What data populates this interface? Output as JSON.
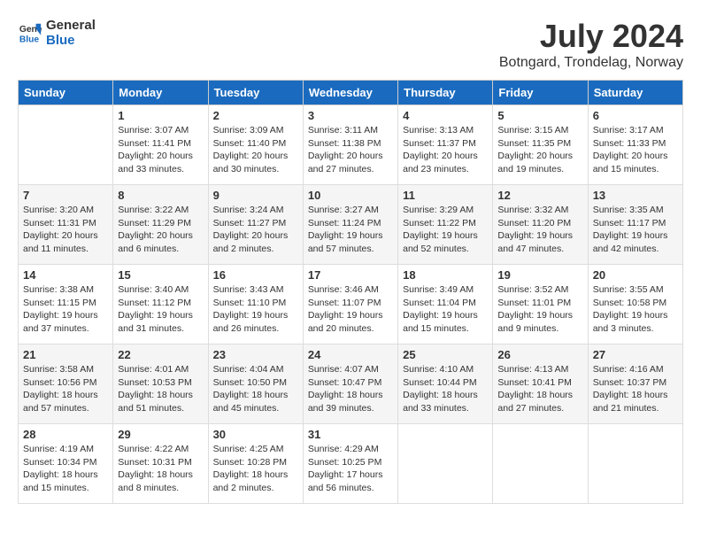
{
  "header": {
    "logo_general": "General",
    "logo_blue": "Blue",
    "title": "July 2024",
    "location": "Botngard, Trondelag, Norway"
  },
  "columns": [
    "Sunday",
    "Monday",
    "Tuesday",
    "Wednesday",
    "Thursday",
    "Friday",
    "Saturday"
  ],
  "weeks": [
    [
      {
        "day": "",
        "info": ""
      },
      {
        "day": "1",
        "info": "Sunrise: 3:07 AM\nSunset: 11:41 PM\nDaylight: 20 hours\nand 33 minutes."
      },
      {
        "day": "2",
        "info": "Sunrise: 3:09 AM\nSunset: 11:40 PM\nDaylight: 20 hours\nand 30 minutes."
      },
      {
        "day": "3",
        "info": "Sunrise: 3:11 AM\nSunset: 11:38 PM\nDaylight: 20 hours\nand 27 minutes."
      },
      {
        "day": "4",
        "info": "Sunrise: 3:13 AM\nSunset: 11:37 PM\nDaylight: 20 hours\nand 23 minutes."
      },
      {
        "day": "5",
        "info": "Sunrise: 3:15 AM\nSunset: 11:35 PM\nDaylight: 20 hours\nand 19 minutes."
      },
      {
        "day": "6",
        "info": "Sunrise: 3:17 AM\nSunset: 11:33 PM\nDaylight: 20 hours\nand 15 minutes."
      }
    ],
    [
      {
        "day": "7",
        "info": "Sunrise: 3:20 AM\nSunset: 11:31 PM\nDaylight: 20 hours\nand 11 minutes."
      },
      {
        "day": "8",
        "info": "Sunrise: 3:22 AM\nSunset: 11:29 PM\nDaylight: 20 hours\nand 6 minutes."
      },
      {
        "day": "9",
        "info": "Sunrise: 3:24 AM\nSunset: 11:27 PM\nDaylight: 20 hours\nand 2 minutes."
      },
      {
        "day": "10",
        "info": "Sunrise: 3:27 AM\nSunset: 11:24 PM\nDaylight: 19 hours\nand 57 minutes."
      },
      {
        "day": "11",
        "info": "Sunrise: 3:29 AM\nSunset: 11:22 PM\nDaylight: 19 hours\nand 52 minutes."
      },
      {
        "day": "12",
        "info": "Sunrise: 3:32 AM\nSunset: 11:20 PM\nDaylight: 19 hours\nand 47 minutes."
      },
      {
        "day": "13",
        "info": "Sunrise: 3:35 AM\nSunset: 11:17 PM\nDaylight: 19 hours\nand 42 minutes."
      }
    ],
    [
      {
        "day": "14",
        "info": "Sunrise: 3:38 AM\nSunset: 11:15 PM\nDaylight: 19 hours\nand 37 minutes."
      },
      {
        "day": "15",
        "info": "Sunrise: 3:40 AM\nSunset: 11:12 PM\nDaylight: 19 hours\nand 31 minutes."
      },
      {
        "day": "16",
        "info": "Sunrise: 3:43 AM\nSunset: 11:10 PM\nDaylight: 19 hours\nand 26 minutes."
      },
      {
        "day": "17",
        "info": "Sunrise: 3:46 AM\nSunset: 11:07 PM\nDaylight: 19 hours\nand 20 minutes."
      },
      {
        "day": "18",
        "info": "Sunrise: 3:49 AM\nSunset: 11:04 PM\nDaylight: 19 hours\nand 15 minutes."
      },
      {
        "day": "19",
        "info": "Sunrise: 3:52 AM\nSunset: 11:01 PM\nDaylight: 19 hours\nand 9 minutes."
      },
      {
        "day": "20",
        "info": "Sunrise: 3:55 AM\nSunset: 10:58 PM\nDaylight: 19 hours\nand 3 minutes."
      }
    ],
    [
      {
        "day": "21",
        "info": "Sunrise: 3:58 AM\nSunset: 10:56 PM\nDaylight: 18 hours\nand 57 minutes."
      },
      {
        "day": "22",
        "info": "Sunrise: 4:01 AM\nSunset: 10:53 PM\nDaylight: 18 hours\nand 51 minutes."
      },
      {
        "day": "23",
        "info": "Sunrise: 4:04 AM\nSunset: 10:50 PM\nDaylight: 18 hours\nand 45 minutes."
      },
      {
        "day": "24",
        "info": "Sunrise: 4:07 AM\nSunset: 10:47 PM\nDaylight: 18 hours\nand 39 minutes."
      },
      {
        "day": "25",
        "info": "Sunrise: 4:10 AM\nSunset: 10:44 PM\nDaylight: 18 hours\nand 33 minutes."
      },
      {
        "day": "26",
        "info": "Sunrise: 4:13 AM\nSunset: 10:41 PM\nDaylight: 18 hours\nand 27 minutes."
      },
      {
        "day": "27",
        "info": "Sunrise: 4:16 AM\nSunset: 10:37 PM\nDaylight: 18 hours\nand 21 minutes."
      }
    ],
    [
      {
        "day": "28",
        "info": "Sunrise: 4:19 AM\nSunset: 10:34 PM\nDaylight: 18 hours\nand 15 minutes."
      },
      {
        "day": "29",
        "info": "Sunrise: 4:22 AM\nSunset: 10:31 PM\nDaylight: 18 hours\nand 8 minutes."
      },
      {
        "day": "30",
        "info": "Sunrise: 4:25 AM\nSunset: 10:28 PM\nDaylight: 18 hours\nand 2 minutes."
      },
      {
        "day": "31",
        "info": "Sunrise: 4:29 AM\nSunset: 10:25 PM\nDaylight: 17 hours\nand 56 minutes."
      },
      {
        "day": "",
        "info": ""
      },
      {
        "day": "",
        "info": ""
      },
      {
        "day": "",
        "info": ""
      }
    ]
  ]
}
